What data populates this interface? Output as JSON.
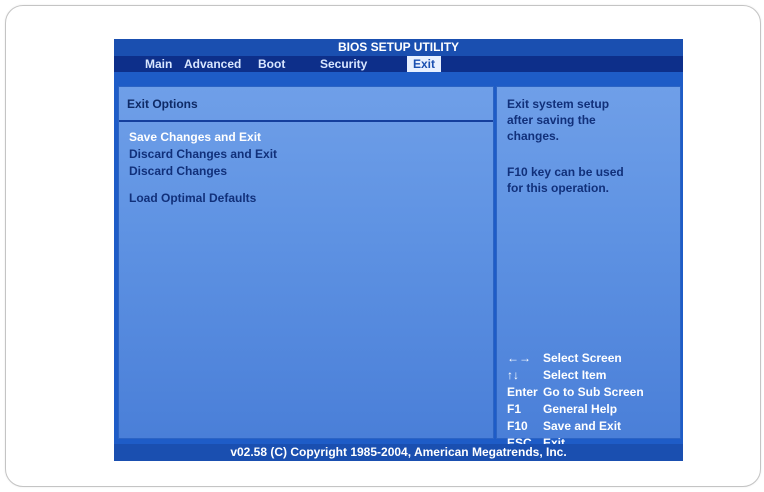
{
  "bios": {
    "title": "BIOS SETUP UTILITY",
    "menu": [
      {
        "label": "Main"
      },
      {
        "label": "Advanced"
      },
      {
        "label": "Boot"
      },
      {
        "label": "Security"
      },
      {
        "label": "Exit"
      }
    ],
    "active_tab": "Exit",
    "section_title": "Exit Options",
    "options": [
      {
        "label": "Save Changes and Exit",
        "selected": true
      },
      {
        "label": "Discard Changes and Exit",
        "selected": false
      },
      {
        "label": "Discard Changes",
        "selected": false
      },
      {
        "label": "Load Optimal Defaults",
        "selected": false
      }
    ],
    "help": {
      "line1": "Exit system setup\nafter saving the\nchanges.",
      "line2": "F10 key can be used\nfor this operation."
    },
    "keys": [
      {
        "key": "←→",
        "desc": "Select Screen"
      },
      {
        "key": "↑↓",
        "desc": "Select Item"
      },
      {
        "key": "Enter",
        "desc": "Go to Sub Screen"
      },
      {
        "key": "F1",
        "desc": "General Help"
      },
      {
        "key": "F10",
        "desc": "Save and Exit"
      },
      {
        "key": "ESC",
        "desc": "Exit"
      }
    ],
    "footer": "v02.58 (C) Copyright  1985-2004, American Megatrends, Inc."
  },
  "colors": {
    "bios_blue": "#1e5cc7",
    "panel_blue": "#5f93e3",
    "menu_dark": "#0d2f8a",
    "text_dark": "#11307a",
    "text_white": "#ffffff"
  }
}
